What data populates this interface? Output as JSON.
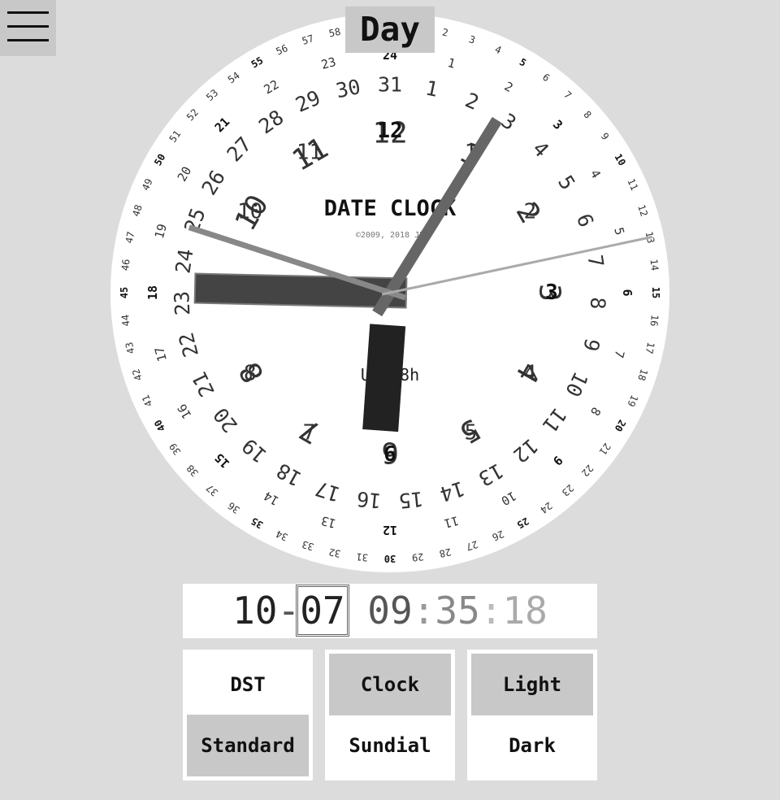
{
  "menu": {
    "icon": "hamburger-menu-icon"
  },
  "header": {
    "mode_label": "Day"
  },
  "clock": {
    "title": "DATE CLOCK",
    "copyright": "©2009, 2018 JP",
    "timezone": "UTC-8h",
    "hour_ring": [
      "1",
      "2",
      "3",
      "4",
      "5",
      "6",
      "7",
      "8",
      "9",
      "10",
      "11",
      "12"
    ],
    "twentyfour_ring": [
      "1",
      "2",
      "3",
      "4",
      "5",
      "6",
      "7",
      "8",
      "9",
      "10",
      "11",
      "12",
      "13",
      "14",
      "15",
      "16",
      "17",
      "18",
      "19",
      "20",
      "21",
      "22",
      "23",
      "24"
    ],
    "day_ring": [
      "1",
      "2",
      "3",
      "4",
      "5",
      "6",
      "7",
      "8",
      "9",
      "10",
      "11",
      "12",
      "13",
      "14",
      "15",
      "16",
      "17",
      "18",
      "19",
      "20",
      "21",
      "22",
      "23",
      "24",
      "25",
      "26",
      "27",
      "28",
      "29",
      "30",
      "31"
    ],
    "minute_ring_count": 60,
    "hands": {
      "hour": 9,
      "minute": 35,
      "second": 18,
      "month": 10,
      "day": 7
    }
  },
  "datetime": {
    "month": "10",
    "sep": "-",
    "day": "07",
    "hour": "09",
    "colon": ":",
    "minute": "35",
    "second": "18"
  },
  "options": {
    "dst": {
      "top_label": "DST",
      "bottom_label": "Standard",
      "selected": "bottom"
    },
    "style": {
      "top_label": "Clock",
      "bottom_label": "Sundial",
      "selected": "top"
    },
    "theme": {
      "top_label": "Light",
      "bottom_label": "Dark",
      "selected": "top"
    }
  }
}
